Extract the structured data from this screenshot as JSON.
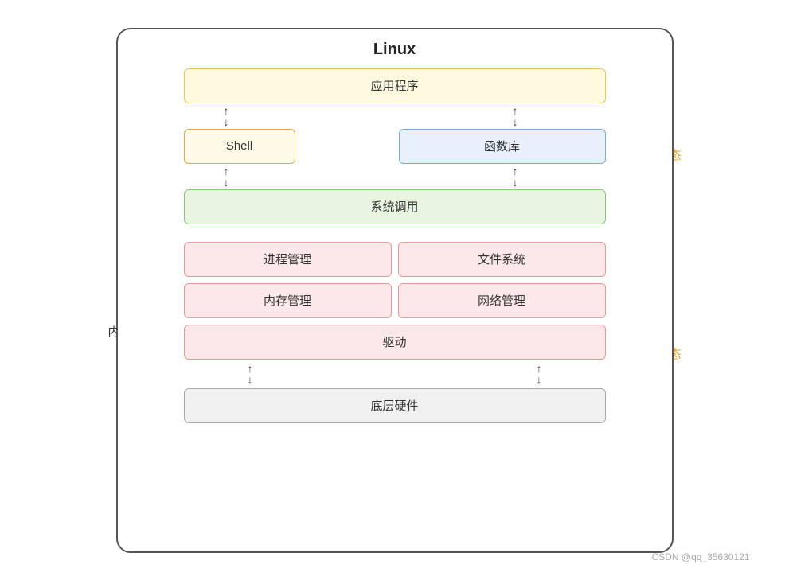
{
  "title": "Linux",
  "layers": {
    "app": "应用程序",
    "shell": "Shell",
    "lib": "函数库",
    "syscall": "系统调用",
    "process": "进程管理",
    "file": "文件系统",
    "memory": "内存管理",
    "network": "网络管理",
    "driver": "驱动",
    "hardware": "底层硬件"
  },
  "labels": {
    "user_mode": "用户态",
    "kernel_mode": "内核态",
    "kernel_func": "内核功能"
  },
  "watermark": "CSDN @qq_35630121"
}
